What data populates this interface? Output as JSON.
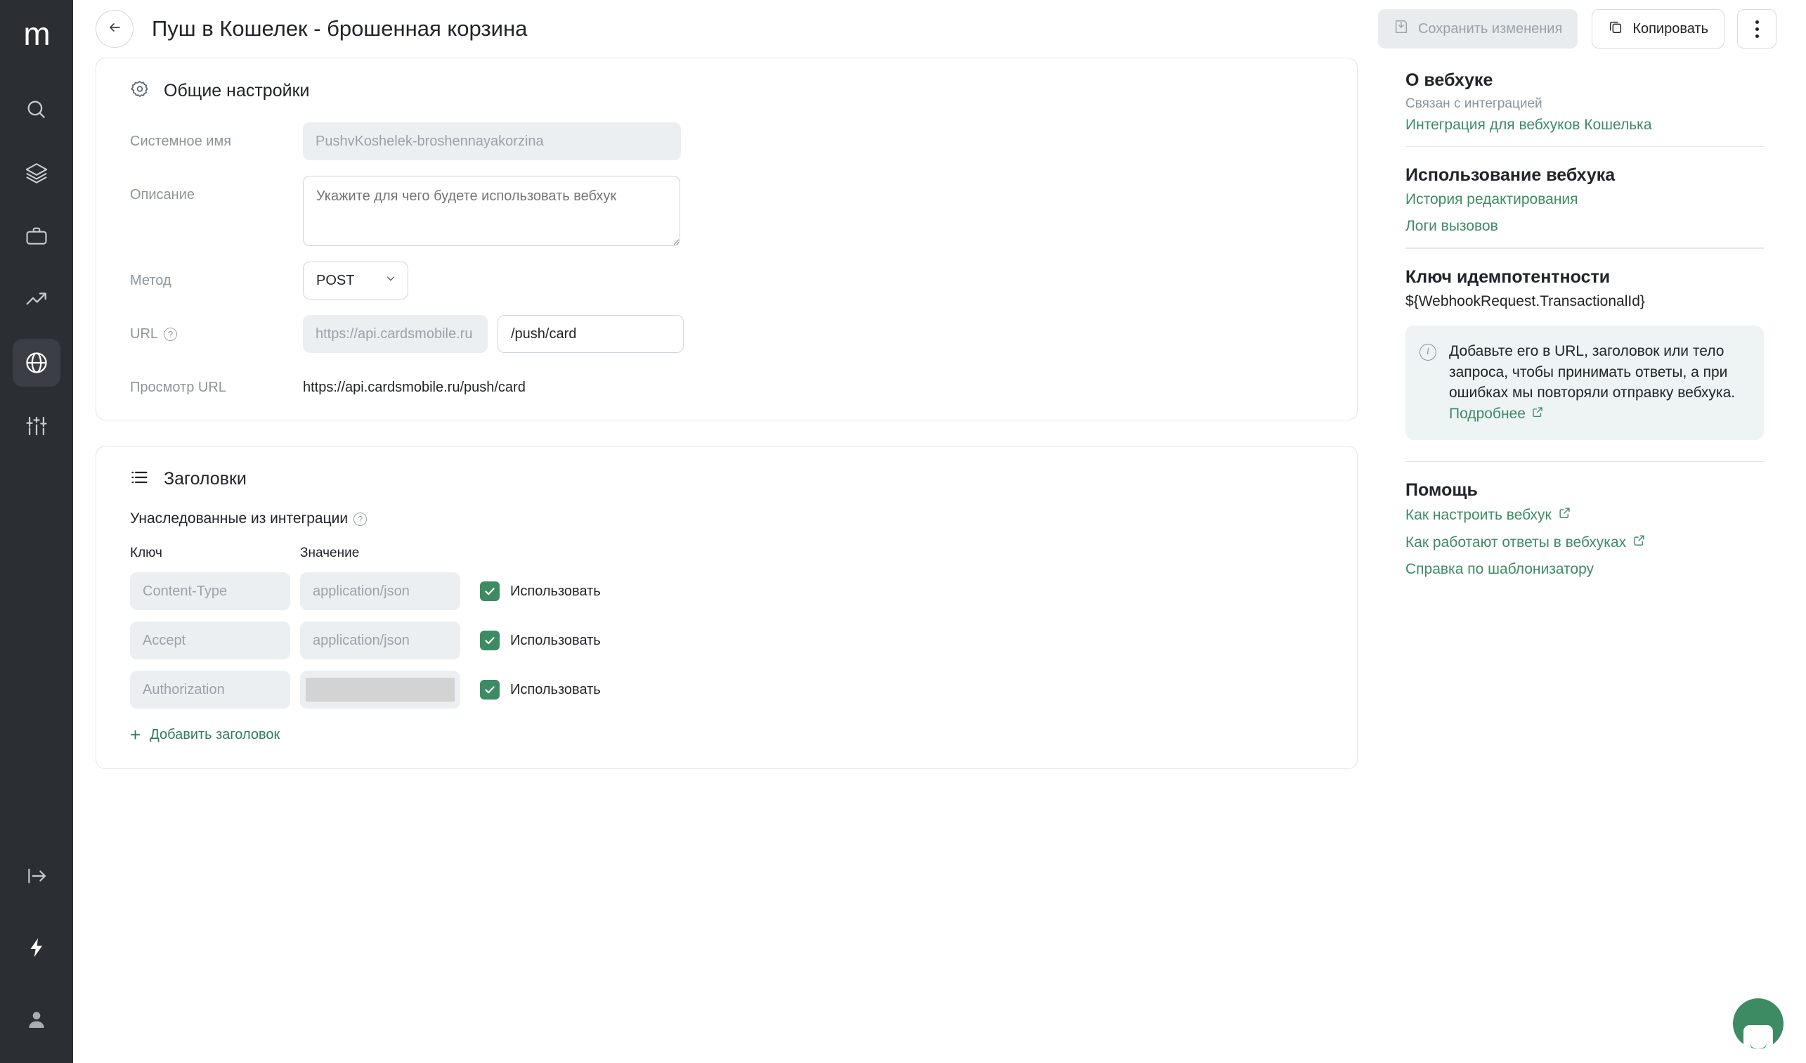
{
  "rail": {
    "logo": "m",
    "items": [
      {
        "icon": "search-icon",
        "name": "search"
      },
      {
        "icon": "layers-icon",
        "name": "layers"
      },
      {
        "icon": "briefcase-icon",
        "name": "briefcase"
      },
      {
        "icon": "trending-up-icon",
        "name": "analytics"
      },
      {
        "icon": "globe-icon",
        "name": "integrations",
        "active": true
      },
      {
        "icon": "sliders-icon",
        "name": "settings"
      }
    ],
    "bottom": [
      {
        "icon": "logout-icon",
        "name": "logout"
      },
      {
        "icon": "lightning-icon",
        "name": "automations"
      },
      {
        "icon": "user-icon",
        "name": "account"
      }
    ]
  },
  "header": {
    "back_label": "←",
    "title": "Пуш в Кошелек - брошенная корзина",
    "save_label": "Сохранить изменения",
    "copy_label": "Копировать"
  },
  "general": {
    "section_title": "Общие настройки",
    "system_name_label": "Системное имя",
    "system_name_value": "PushvKoshelek-broshennayakorzina",
    "description_label": "Описание",
    "description_placeholder": "Укажите для чего будете использовать вебхук",
    "description_value": "",
    "method_label": "Метод",
    "method_value": "POST",
    "url_label": "URL",
    "url_base_value": "https://api.cardsmobile.ru",
    "url_path_value": "/push/card",
    "preview_label": "Просмотр URL",
    "preview_value": "https://api.cardsmobile.ru/push/card"
  },
  "headers": {
    "section_title": "Заголовки",
    "inherited_label": "Унаследованные из интеграции",
    "col_key": "Ключ",
    "col_value": "Значение",
    "use_label": "Использовать",
    "add_label": "Добавить заголовок",
    "rows": [
      {
        "key": "Content-Type",
        "value": "application/json",
        "masked": false,
        "checked": true
      },
      {
        "key": "Accept",
        "value": "application/json",
        "masked": false,
        "checked": true
      },
      {
        "key": "Authorization",
        "value": "",
        "masked": true,
        "checked": true
      }
    ]
  },
  "aside": {
    "about_title": "О вебхуке",
    "about_sub": "Связан с интеграцией",
    "about_link": "Интеграция для вебхуков Кошелька",
    "usage_title": "Использование вебхука",
    "usage_link1": "История редактирования",
    "usage_link2": "Логи вызовов",
    "idem_title": "Ключ идемпотентности",
    "idem_value": "${WebhookRequest.TransactionalId}",
    "info_text": "Добавьте его в URL, заголовок или тело запроса, чтобы принимать ответы, а при ошибках мы повторяли отправку вебхука. ",
    "info_more": "Подробнее",
    "help_title": "Помощь",
    "help_link1": "Как настроить вебхук",
    "help_link2": "Как работают ответы в вебхуках",
    "help_link3": "Справка по шаблонизатору"
  },
  "colors": {
    "rail_bg": "#2b2e33",
    "rail_active": "#3b3e44",
    "accent_green": "#3d8b63",
    "link_green": "#2f7d57",
    "field_readonly": "#eceff1",
    "border": "#dfe5ea",
    "info_bg": "#eef3f4"
  }
}
